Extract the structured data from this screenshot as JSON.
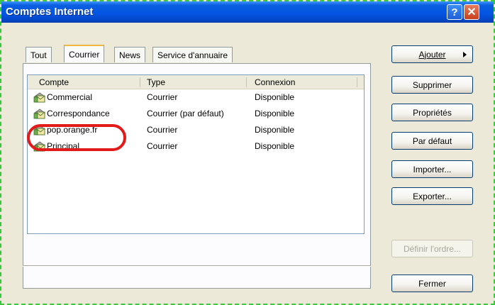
{
  "window": {
    "title": "Comptes Internet",
    "help_label": "?",
    "close_label": "✕"
  },
  "tabs": [
    {
      "label": "Tout",
      "active": false
    },
    {
      "label": "Courrier",
      "active": true
    },
    {
      "label": "News",
      "active": false
    },
    {
      "label": "Service d'annuaire",
      "active": false
    }
  ],
  "list": {
    "columns": [
      "Compte",
      "Type",
      "Connexion"
    ],
    "rows": [
      {
        "compte": "Commercial",
        "type": "Courrier",
        "connexion": "Disponible"
      },
      {
        "compte": "Correspondance",
        "type": "Courrier (par défaut)",
        "connexion": "Disponible"
      },
      {
        "compte": "pop.orange.fr",
        "type": "Courrier",
        "connexion": "Disponible"
      },
      {
        "compte": "Principal",
        "type": "Courrier",
        "connexion": "Disponible"
      }
    ],
    "highlighted_row": "pop.orange.fr",
    "highlight_color": "#e21a1a"
  },
  "buttons": {
    "ajouter": "Ajouter",
    "supprimer": "Supprimer",
    "proprietes": "Propriétés",
    "par_defaut": "Par défaut",
    "importer": "Importer...",
    "exporter": "Exporter...",
    "definir_ordre": "Définir l'ordre...",
    "fermer": "Fermer"
  },
  "icons": {
    "account": "mail-account-icon",
    "add_submenu": "triangle-right-icon"
  }
}
